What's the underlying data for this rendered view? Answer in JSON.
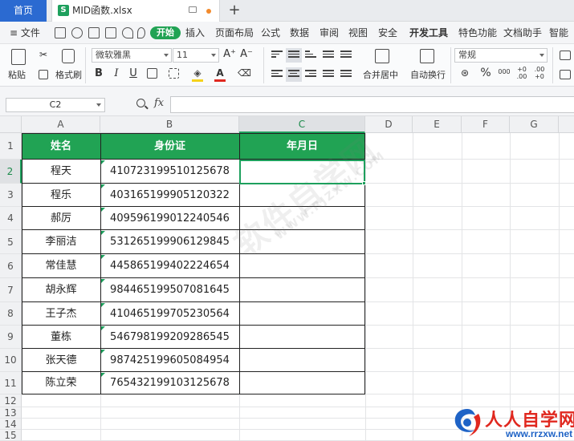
{
  "tabs": {
    "home": "首页",
    "file_icon": "S",
    "file_name": "MID函数.xlsx",
    "add": "+"
  },
  "menubar": {
    "file": "≡ 文件",
    "start": "开始",
    "items": [
      "插入",
      "页面布局",
      "公式",
      "数据",
      "审阅",
      "视图",
      "安全",
      "开发工具",
      "特色功能",
      "文档助手",
      "智能"
    ]
  },
  "ribbon": {
    "paste": "粘贴",
    "format_painter": "格式刷",
    "font_name": "微软雅黑",
    "font_size": "11",
    "merge_center": "合并居中",
    "wrap_text": "自动换行",
    "number_format": "常规",
    "percent": "%",
    "thousands": "000",
    "dec_inc": "+0 .00",
    "dec_dec": ".00 +0",
    "bold": "B",
    "italic": "I",
    "underline": "U",
    "font_grow": "A⁺",
    "font_shrink": "A⁻"
  },
  "formula_bar": {
    "cell_ref": "C2",
    "fx": "fx",
    "value": ""
  },
  "columns": [
    "A",
    "B",
    "C",
    "D",
    "E",
    "F",
    "G"
  ],
  "rows": [
    "1",
    "2",
    "3",
    "4",
    "5",
    "6",
    "7",
    "8",
    "9",
    "10",
    "11",
    "12",
    "13",
    "14",
    "15"
  ],
  "table": {
    "headers": [
      "姓名",
      "身份证",
      "年月日"
    ],
    "rows": [
      [
        "程天",
        "410723199510125678",
        ""
      ],
      [
        "程乐",
        "403165199905120322",
        ""
      ],
      [
        "郝厉",
        "409596199012240546",
        ""
      ],
      [
        "李丽洁",
        "531265199906129845",
        ""
      ],
      [
        "常佳慧",
        "445865199402224654",
        ""
      ],
      [
        "胡永辉",
        "984465199507081645",
        ""
      ],
      [
        "王子杰",
        "410465199705230564",
        ""
      ],
      [
        "董栋",
        "546798199209286545",
        ""
      ],
      [
        "张天德",
        "987425199605084954",
        ""
      ],
      [
        "陈立荣",
        "765432199103125678",
        ""
      ]
    ]
  },
  "watermark": {
    "main": "软件自学网",
    "sub": "WWW.RJZXW.COM"
  },
  "logo": {
    "brand": "人人自学网",
    "url": "www.rrzxw.net"
  },
  "colors": {
    "accent_green": "#21a354",
    "tab_blue": "#2b6ad1",
    "logo_red": "#e0281f",
    "logo_blue": "#1f63c6"
  }
}
